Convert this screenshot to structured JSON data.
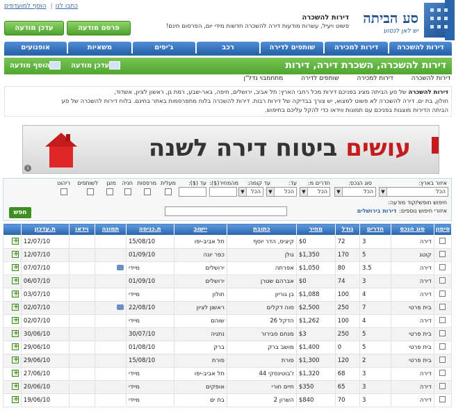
{
  "top_links": {
    "write_us": "כתבו לנו",
    "add_favorites": "הוסף למועדפים"
  },
  "logo": {
    "title": "סע הביתה",
    "subtitle": "יש לאן לנסוע"
  },
  "intro": {
    "title": "דירות להשכרה",
    "text": "פשוט ויעיל, עשרות מודעות דירה להשכרה חדשות מידי יום, הפרסום חינם!"
  },
  "buttons": {
    "publish": "פרסם מודעה",
    "update": "עדכן מודעה"
  },
  "nav_tabs": [
    "דירות להשכרה",
    "דירות למכירה",
    "שותפים לדירה",
    "רכב",
    "ג'יפים",
    "משאיות",
    "אופנועים"
  ],
  "header": {
    "title": "דירות להשכרה, השכרת דירה, דירות",
    "update_ad": "עדכן מודעה",
    "add_ad": "הוסף מודעה"
  },
  "sub_nav": [
    "דירות להשכרה",
    "דירות למכירה",
    "שותפים לדירה",
    "מתחמבוי נדל\"ן"
  ],
  "description": {
    "bold": "דירות להשכרה",
    "line1": " של סע הביתה מציג בפניכם דירות מכל רחבי הארץ: תל אביב, ירושלים, חיפה, באר-שבע, רמת גן, ראשון לציון, אשדוד,",
    "line2": "חולון, בת ים. דירה להשכרה לא פשוט למצוא, יש צורך בבדיקה של דירות רבות. דירות להשכרה בלוח מתפרסמות באתר בחינם. בלוח דירות להשכרה של סע",
    "line3": "הביתה הדירות מוצגות בפניכם עם תמונות ווידאו כדי להקל עליכם בחיפוש."
  },
  "banner": {
    "word1": "עושים",
    "word2": "ביטוח דירה לשנה"
  },
  "search": {
    "labels": {
      "area": "איזור בארץ:",
      "type": "סוג הנכס:",
      "rooms": "חדרים מ:",
      "to": "עד:",
      "floor": "עד קומה:",
      "price_from": "מהמחיר($):",
      "price_to": "עד ($):",
      "elevator": "מעלית",
      "terraces": "מרפסות",
      "parking": "חניה",
      "renovated": "מזגן",
      "partners": "לשותפים",
      "furnished": "ריהוט"
    },
    "default_option": "הכל",
    "free_search": "חיפוש חופשי/קוד מודעה:",
    "more_areas": "איזורי חיפוש נוספים:",
    "more_link": "דירות בירושלים",
    "submit": "חפש"
  },
  "table": {
    "headers": [
      "סימון",
      "סוג הנכס",
      "חדרים",
      "גודל",
      "מחיר",
      "כתובת",
      "יישוב",
      "ת.כניסה",
      "תמונה",
      "וידאו",
      "ת.עדכון",
      ""
    ],
    "rows": [
      [
        "דירה",
        "3",
        "72",
        "$0",
        "קיציס, הדר יוסף",
        "תל אביב-יפו",
        "15/08/10",
        "",
        "12/07/10"
      ],
      [
        "קוטג",
        "5",
        "170",
        "$1,350",
        "גולן",
        "כפר יונה",
        "01/09/10",
        "",
        "12/07/10"
      ],
      [
        "דירה",
        "3.5",
        "80",
        "$1,050",
        "אפרתה",
        "ירושלים",
        "מיידי",
        "cam",
        "07/07/10"
      ],
      [
        "דירה",
        "3",
        "74",
        "$0",
        "אברהם שטרן",
        "ירושלים",
        "01/09/10",
        "",
        "06/07/10"
      ],
      [
        "דירה",
        "4",
        "100",
        "$1,088",
        "בן גוריון",
        "חולון",
        "מיידי",
        "",
        "03/07/10"
      ],
      [
        "בית פרטי",
        "7",
        "250",
        "$2,500",
        "סוה דקלים",
        "ראשון לציון",
        "22/08/10",
        "cam",
        "02/07/10"
      ],
      [
        "דירה",
        "4",
        "100",
        "$1,262",
        "הדקל 26",
        "שוהם",
        "מיידי",
        "",
        "02/07/10"
      ],
      [
        "בית פרטי",
        "5",
        "250",
        "$3",
        "מנחם סבירור",
        "נתניה",
        "30/07/10",
        "",
        "30/06/10"
      ],
      [
        "בית פרטי",
        "5",
        "0",
        "$1,400",
        "מושב ברק",
        "ברק",
        "01/08/10",
        "",
        "29/06/10"
      ],
      [
        "בית פרטי",
        "2",
        "120",
        "$1,300",
        "פורת",
        "פורת",
        "15/08/10",
        "",
        "29/06/10"
      ],
      [
        "דירה",
        "3",
        "68",
        "$1,320",
        "ז'בוטינסקי 44",
        "תל אביב-יפו",
        "מיידי",
        "",
        "27/06/10"
      ],
      [
        "דירה",
        "3",
        "65",
        "$350",
        "חיים חורי",
        "אופקים",
        "מיידי",
        "",
        "20/06/10"
      ],
      [
        "דירה",
        "3",
        "70",
        "$840",
        "השרון 2",
        "בת ים",
        "מיידי",
        "",
        "19/06/10"
      ]
    ]
  }
}
